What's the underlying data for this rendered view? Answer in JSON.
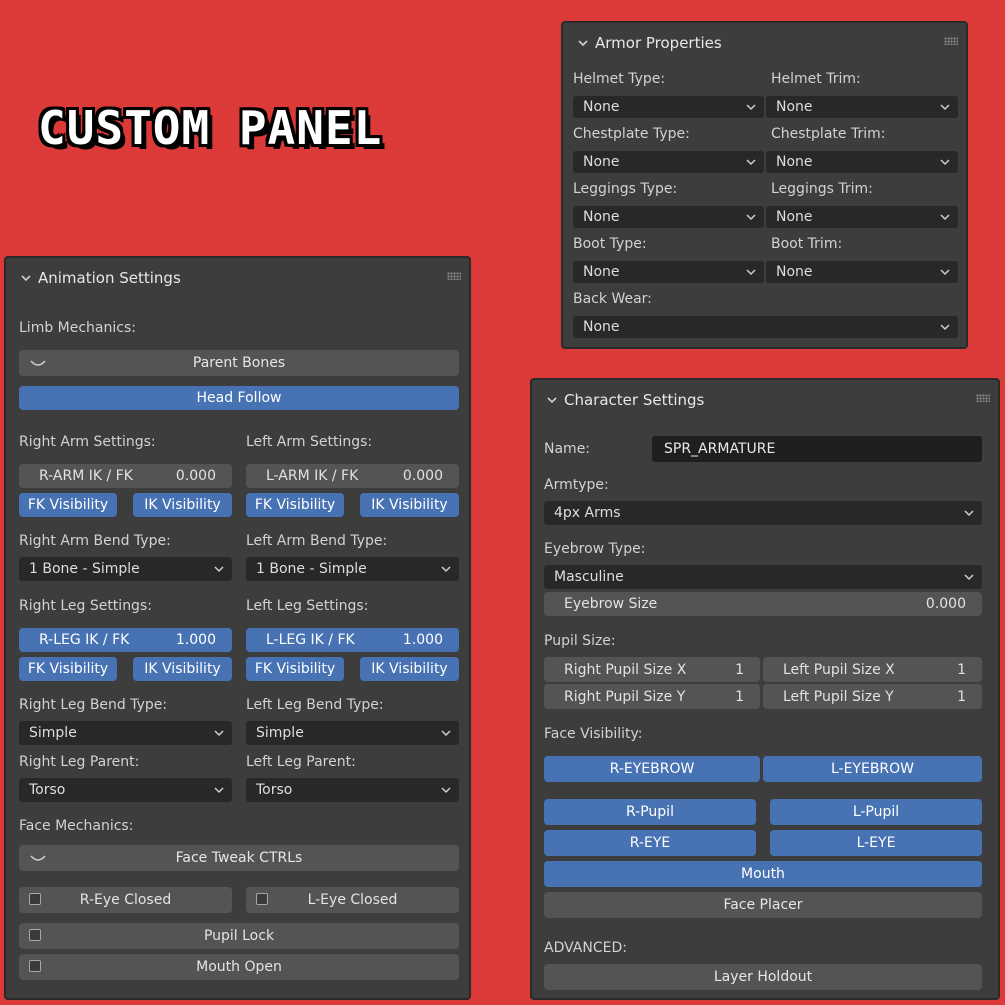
{
  "banner": {
    "title": "CUSTOM PANEL"
  },
  "armor": {
    "title": "Armor Properties",
    "fields": [
      {
        "label": "Helmet Type:",
        "value": "None"
      },
      {
        "label": "Helmet Trim:",
        "value": "None"
      },
      {
        "label": "Chestplate Type:",
        "value": "None"
      },
      {
        "label": "Chestplate Trim:",
        "value": "None"
      },
      {
        "label": "Leggings Type:",
        "value": "None"
      },
      {
        "label": "Leggings Trim:",
        "value": "None"
      },
      {
        "label": "Boot Type:",
        "value": "None"
      },
      {
        "label": "Boot Trim:",
        "value": "None"
      },
      {
        "label": "Back Wear:",
        "value": "None"
      }
    ]
  },
  "anim": {
    "title": "Animation Settings",
    "limb_mechanics": "Limb Mechanics:",
    "parent_bones": "Parent Bones",
    "head_follow": "Head Follow",
    "right_arm_settings": "Right Arm Settings:",
    "left_arm_settings": "Left Arm Settings:",
    "r_arm_ikfk": {
      "label": "R-ARM IK / FK",
      "value": "0.000"
    },
    "l_arm_ikfk": {
      "label": "L-ARM IK / FK",
      "value": "0.000"
    },
    "fk_visibility": "FK Visibility",
    "ik_visibility": "IK Visibility",
    "right_arm_bend_type": "Right Arm Bend Type:",
    "left_arm_bend_type": "Left Arm Bend Type:",
    "right_arm_bend_value": "1 Bone - Simple",
    "left_arm_bend_value": "1 Bone - Simple",
    "right_leg_settings": "Right Leg Settings:",
    "left_leg_settings": "Left Leg Settings:",
    "r_leg_ikfk": {
      "label": "R-LEG IK / FK",
      "value": "1.000"
    },
    "l_leg_ikfk": {
      "label": "L-LEG IK / FK",
      "value": "1.000"
    },
    "right_leg_bend_type": "Right Leg Bend Type:",
    "left_leg_bend_type": "Left Leg Bend Type:",
    "right_leg_bend_value": "Simple",
    "left_leg_bend_value": "Simple",
    "right_leg_parent": "Right Leg Parent:",
    "left_leg_parent": "Left Leg Parent:",
    "right_leg_parent_value": "Torso",
    "left_leg_parent_value": "Torso",
    "face_mechanics": "Face Mechanics:",
    "face_tweak": "Face Tweak CTRLs",
    "r_eye_closed": "R-Eye Closed",
    "l_eye_closed": "L-Eye Closed",
    "pupil_lock": "Pupil Lock",
    "mouth_open": "Mouth Open"
  },
  "character": {
    "title": "Character Settings",
    "name_label": "Name:",
    "name_value": "SPR_ARMATURE",
    "armtype_label": "Armtype:",
    "armtype_value": "4px Arms",
    "eyebrow_type_label": "Eyebrow Type:",
    "eyebrow_type_value": "Masculine",
    "eyebrow_size": {
      "label": "Eyebrow Size",
      "value": "0.000"
    },
    "pupil_size_label": "Pupil Size:",
    "right_pupil_x": {
      "label": "Right Pupil Size X",
      "value": "1"
    },
    "left_pupil_x": {
      "label": "Left Pupil Size X",
      "value": "1"
    },
    "right_pupil_y": {
      "label": "Right Pupil Size Y",
      "value": "1"
    },
    "left_pupil_y": {
      "label": "Left Pupil Size Y",
      "value": "1"
    },
    "face_visibility_label": "Face Visibility:",
    "r_eyebrow": "R-EYEBROW",
    "l_eyebrow": "L-EYEBROW",
    "r_pupil": "R-Pupil",
    "l_pupil": "L-Pupil",
    "r_eye": "R-EYE",
    "l_eye": "L-EYE",
    "mouth": "Mouth",
    "face_placer": "Face Placer",
    "advanced_label": "ADVANCED:",
    "layer_holdout": "Layer Holdout"
  },
  "colors": {
    "background": "#dc3a38",
    "panel": "#3d3d3d",
    "button": "#545454",
    "accent_blue": "#4772b3",
    "dropdown": "#282828"
  }
}
